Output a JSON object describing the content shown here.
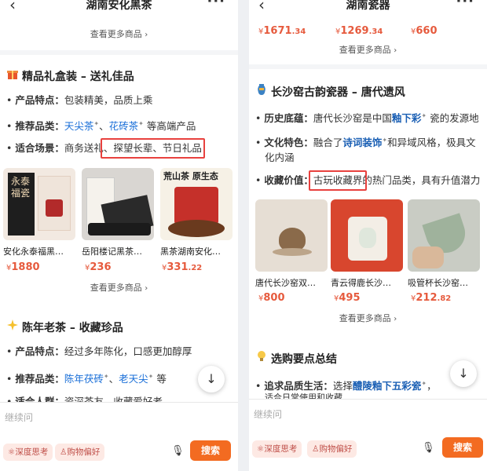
{
  "left": {
    "title": "湖南安化黑茶",
    "top_more": "查看更多商品",
    "section1": {
      "icon": "gift-icon",
      "title": "精品礼盒装 – 送礼佳品",
      "b1_key": "产品特点：",
      "b1_val": "包装精美，品质上乘",
      "b2_key": "推荐品类：",
      "b2_link1": "天尖茶",
      "b2_sep": "、",
      "b2_link2": "花砖茶",
      "b2_tail": "等高端产品",
      "b3_key": "适合场景：",
      "b3_pre": "商务送礼、",
      "b3_hl": "探望长辈、节日礼品"
    },
    "products": [
      {
        "name": "安化永泰福黑…",
        "price": "1880",
        "img_text": "永泰福瓷"
      },
      {
        "name": "岳阳楼记黑茶…",
        "price": "236",
        "img_text": ""
      },
      {
        "name": "黑茶湖南安化…",
        "price": "331",
        "price_dec": ".22",
        "img_text": "荒山茶 原生态"
      }
    ],
    "bottom_more": "查看更多商品",
    "section2": {
      "icon": "sparkle-icon",
      "title": "陈年老茶 – 收藏珍品",
      "b1_key": "产品特点：",
      "b1_val": "经过多年陈化，口感更加醇厚",
      "b2_key": "推荐品类：",
      "b2_link1": "陈年茯砖",
      "b2_sep": "、",
      "b2_link2": "老天尖",
      "b2_tail": "等",
      "b3_key": "适合人群：",
      "b3_val": "资深茶友、收藏爱好者"
    },
    "input": {
      "placeholder": "继续问",
      "chip1": "深度思考",
      "chip2": "购物偏好",
      "search": "搜索"
    }
  },
  "right": {
    "title": "湖南瓷器",
    "top_prices": [
      {
        "int": "1671",
        "dec": ".34"
      },
      {
        "int": "1269",
        "dec": ".34"
      },
      {
        "int": "660",
        "dec": ""
      }
    ],
    "top_more": "查看更多商品",
    "section1": {
      "icon": "vase-icon",
      "title": "长沙窑古韵瓷器 – 唐代遗风",
      "b1_key": "历史底蕴：",
      "b1_pre": "唐代长沙窑是中国",
      "b1_link": "釉下彩",
      "b1_tail": "瓷的发源地",
      "b2_key": "文化特色：",
      "b2_pre": "融合了",
      "b2_link": "诗词装饰",
      "b2_tail": "和异域风格，极具文",
      "b2_line2": "化内涵",
      "b3_key": "收藏价值：",
      "b3_hl": "古玩收藏界的",
      "b3_tail": "热门品类，具有升值潜力"
    },
    "products": [
      {
        "name": "唐代长沙窑双…",
        "price": "800",
        "price_dec": ""
      },
      {
        "name": "青云得鹿长沙…",
        "price": "495",
        "price_dec": ""
      },
      {
        "name": "吸管杯长沙窑…",
        "price": "212",
        "price_dec": ".82"
      }
    ],
    "bottom_more": "查看更多商品",
    "section2": {
      "icon": "bulb-icon",
      "title": "选购要点总结",
      "b1_key": "追求品质生活：",
      "b1_pre": "选择",
      "b1_link": "醴陵釉下五彩瓷",
      "b1_tail": "，",
      "b1_line2": "适合日常使用和收藏"
    },
    "input": {
      "placeholder": "继续问",
      "chip1": "深度思考",
      "chip2": "购物偏好",
      "search": "搜索"
    }
  },
  "currency": "¥",
  "colors": {
    "price": "#e65a3d",
    "link": "#1a6fd8",
    "highlight": "#e8413e",
    "search": "#f36b21"
  }
}
